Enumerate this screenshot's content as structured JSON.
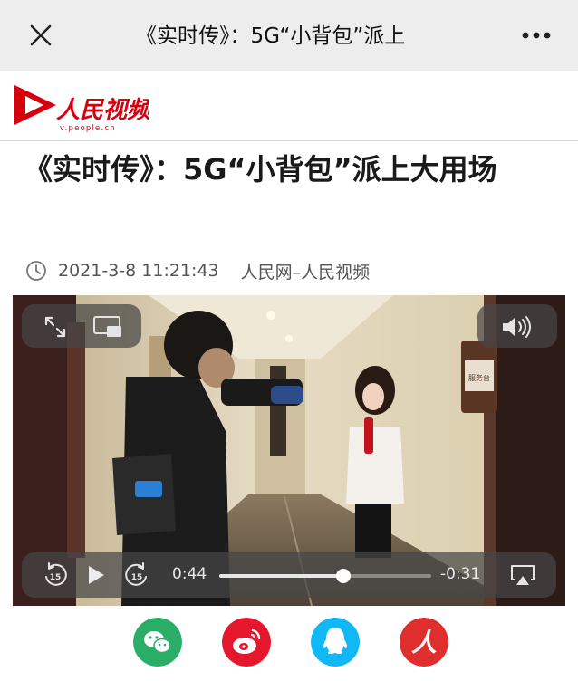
{
  "navbar": {
    "title": "《实时传》：5G“小背包”派上",
    "close_icon": "close-icon",
    "more_icon": "more-dots-icon"
  },
  "brand": {
    "logo_text": "人民视频",
    "logo_url_text": "v.people.cn",
    "logo_color": "#d7000f"
  },
  "article": {
    "headline": "《实时传》：5G“小背包”派上大用场",
    "date": "2021-3-8 11:21:43",
    "source": "人民网–人民视频"
  },
  "video": {
    "controls": {
      "fullscreen_icon": "expand-arrows-icon",
      "pip_icon": "picture-in-picture-icon",
      "volume_icon": "speaker-volume-icon",
      "skip_back_icon": "skip-back-15-icon",
      "play_icon": "play-icon",
      "skip_forward_icon": "skip-forward-15-icon",
      "airplay_icon": "airplay-icon",
      "skip_seconds": "15",
      "elapsed": "0:44",
      "remaining": "-0:31",
      "progress": 0.587
    },
    "sign_text": "服务台"
  },
  "share": [
    {
      "name": "wechat",
      "icon": "wechat-icon",
      "color": "#2aae67"
    },
    {
      "name": "weibo",
      "icon": "weibo-icon",
      "color": "#e6162d"
    },
    {
      "name": "qq",
      "icon": "qq-icon",
      "color": "#12b7f5"
    },
    {
      "name": "people",
      "icon": "people-daily-icon",
      "color": "#e02d2d",
      "glyph": "人"
    }
  ]
}
